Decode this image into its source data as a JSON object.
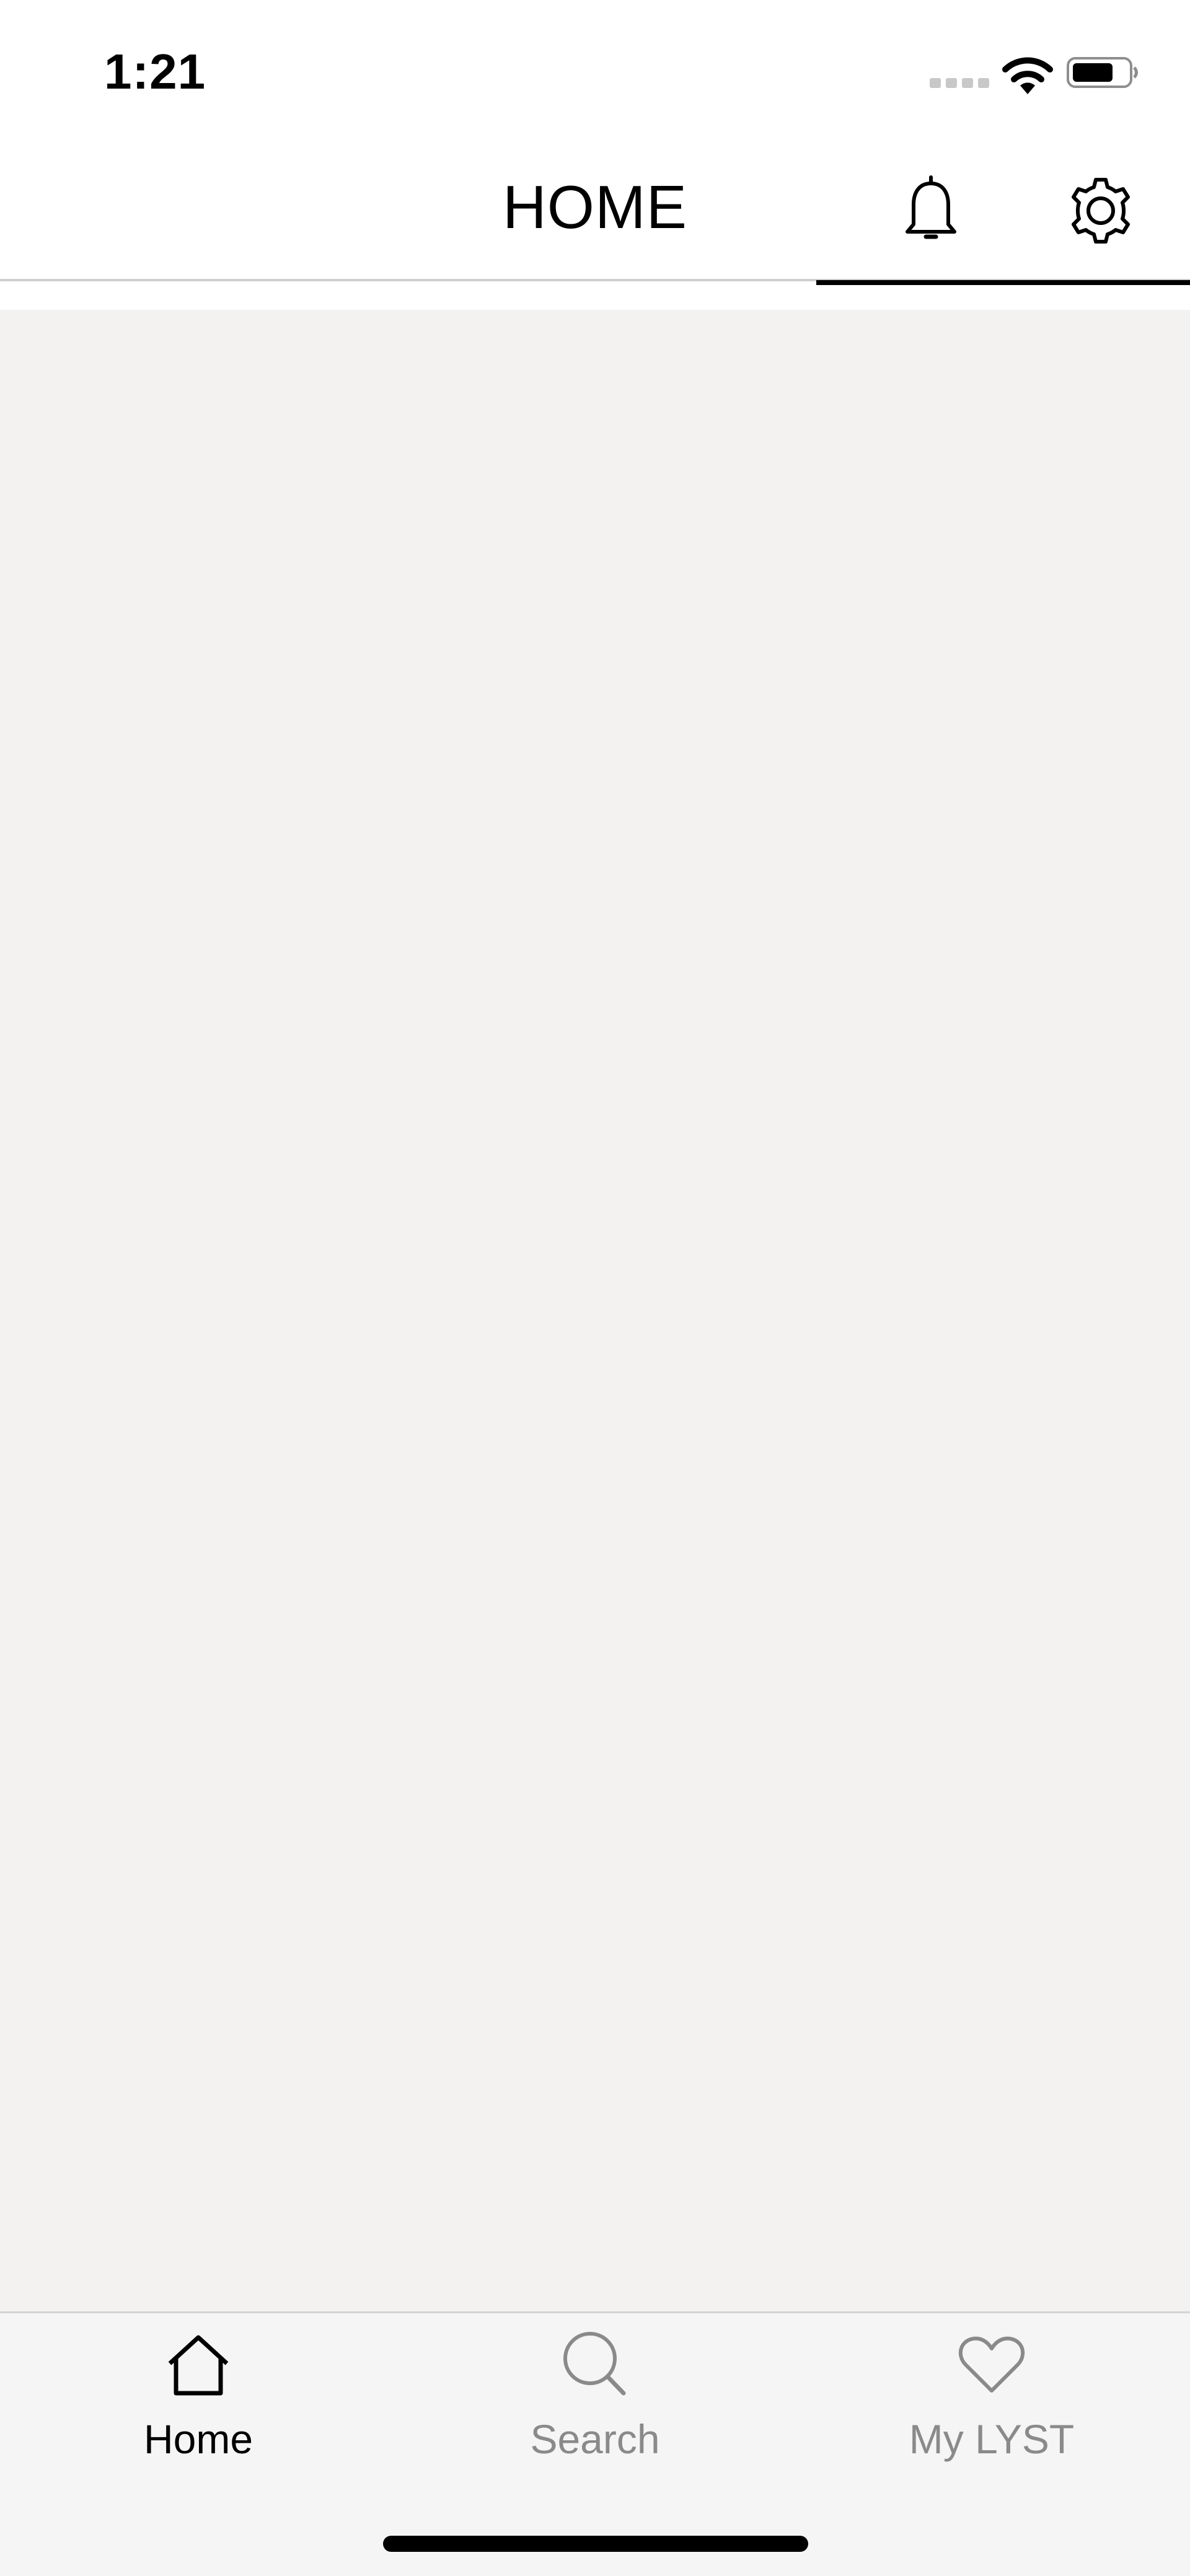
{
  "status_bar": {
    "time": "1:21",
    "icons": [
      "cellular-signal-icon",
      "wifi-icon",
      "battery-icon"
    ]
  },
  "header": {
    "title": "HOME",
    "actions": [
      "bell-icon",
      "gear-icon"
    ]
  },
  "tab_bar": {
    "tabs": [
      {
        "label": "Home",
        "icon": "home-icon",
        "active": true
      },
      {
        "label": "Search",
        "icon": "search-icon",
        "active": false
      },
      {
        "label": "My LYST",
        "icon": "heart-icon",
        "active": false
      }
    ]
  },
  "colors": {
    "content_background": "#f3f2f1",
    "tab_bar_background": "#f5f5f5",
    "active_tab": "#000000",
    "inactive_tab": "#8a8a8a"
  }
}
